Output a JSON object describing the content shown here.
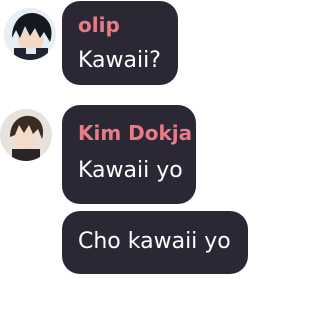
{
  "colors": {
    "bubble_bg": "#2b2734",
    "sender_name": "#e97b86",
    "message_text": "#ffffff",
    "page_bg": "#ffffff"
  },
  "messages": [
    {
      "sender": "olip",
      "text": "Kawaii?",
      "avatar_icon": "anime-boy-dark-hair-avatar"
    },
    {
      "sender": "Kim Dokja",
      "text": "Kawaii yo",
      "avatar_icon": "anime-boy-brown-hair-avatar"
    },
    {
      "sender": "",
      "text": "Cho kawaii yo"
    }
  ]
}
